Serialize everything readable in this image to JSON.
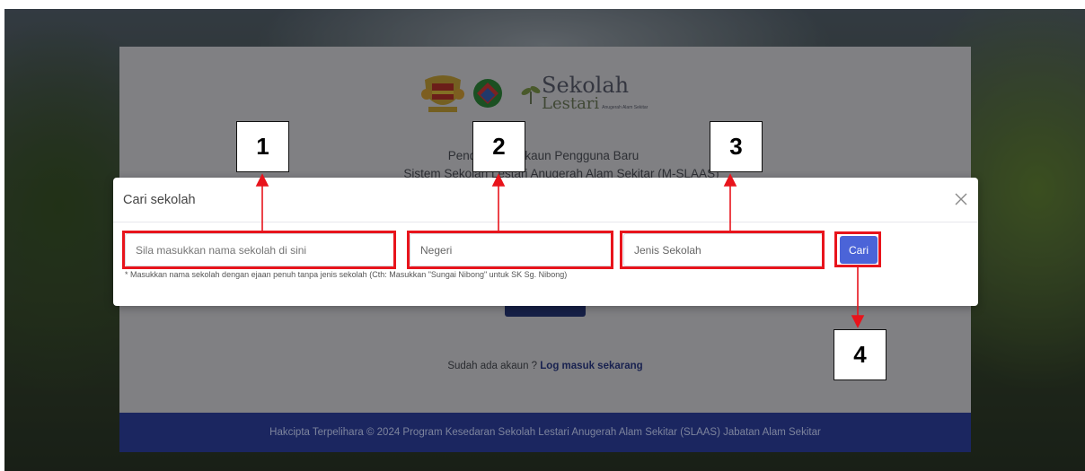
{
  "background_page": {
    "brand": {
      "name": "Sekolah",
      "sub": "Lestari",
      "tagline": "Anugerah Alam Sekitar"
    },
    "title": "Pendaftaran Akaun Pengguna Baru",
    "subtitle": "Sistem Sekolah Lestari Anugerah Alam Sekitar (M-SLAAS)",
    "login_prompt": "Sudah ada akaun ?",
    "login_link": "Log masuk sekarang",
    "footer": "Hakcipta Terpelihara © 2024 Program Kesedaran Sekolah Lestari Anugerah Alam Sekitar (SLAAS) Jabatan Alam Sekitar"
  },
  "modal": {
    "title": "Cari sekolah",
    "close_icon": "close-icon",
    "school_input": {
      "placeholder": "Sila masukkan nama sekolah di sini",
      "value": ""
    },
    "state_select": {
      "value": "Negeri"
    },
    "type_select": {
      "value": "Jenis Sekolah"
    },
    "hint": "* Masukkan nama sekolah dengan ejaan penuh tanpa jenis sekolah (Cth: Masukkan \"Sungai Nibong\" untuk SK Sg. Nibong)",
    "search_button": "Cari"
  },
  "callouts": [
    "1",
    "2",
    "3",
    "4"
  ],
  "colors": {
    "highlight": "#e8141c",
    "primary": "#4b64d8",
    "footer": "#1b2660"
  }
}
